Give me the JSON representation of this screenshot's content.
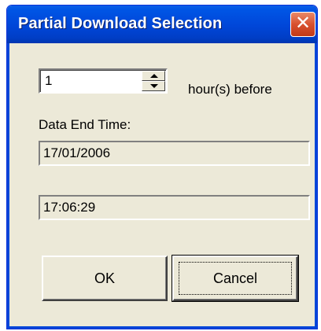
{
  "window": {
    "title": "Partial Download Selection",
    "close_symbol": "✕"
  },
  "hours_spinner": {
    "value": "1",
    "suffix_label": "hour(s)  before"
  },
  "data_end_time": {
    "label": "Data End Time:",
    "date": "17/01/2006",
    "time": "17:06:29"
  },
  "buttons": {
    "ok": "OK",
    "cancel": "Cancel"
  },
  "colors": {
    "titlebar": "#0046D8",
    "dialog_bg": "#ECE9D8",
    "close_button": "#D8502F"
  }
}
